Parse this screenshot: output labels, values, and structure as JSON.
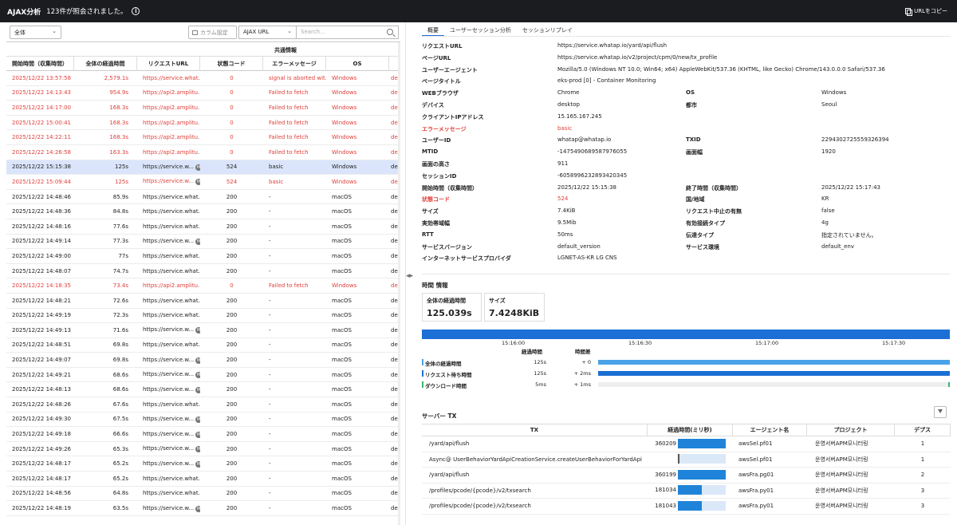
{
  "header": {
    "title": "AJAX分析",
    "count_text": "123件が照会されました。",
    "copy_url": "URLをコピー"
  },
  "filters": {
    "scope": "全体",
    "column_settings": "カラム設定",
    "field": "AJAX URL",
    "search_placeholder": "Search..."
  },
  "list": {
    "group_header": "共通情報",
    "columns": [
      "開始時間（収集時間）",
      "全体の経過時間",
      "リクエストURL",
      "状態コード",
      "エラーメッセージ",
      "OS"
    ],
    "rows": [
      {
        "time": "2025/12/22 13:57:58",
        "elapsed": "2,579.1s",
        "url": "https://service.what...",
        "status": "0",
        "error": "signal is aborted wit...",
        "os": "Windows",
        "extra": "de",
        "state": "error"
      },
      {
        "time": "2025/12/22 14:13:43",
        "elapsed": "954.9s",
        "url": "https://api2.amplitu...",
        "status": "0",
        "error": "Failed to fetch",
        "os": "Windows",
        "extra": "de",
        "state": "error"
      },
      {
        "time": "2025/12/22 14:17:00",
        "elapsed": "168.3s",
        "url": "https://api2.amplitu...",
        "status": "0",
        "error": "Failed to fetch",
        "os": "Windows",
        "extra": "de",
        "state": "error"
      },
      {
        "time": "2025/12/22 15:00:41",
        "elapsed": "168.3s",
        "url": "https://api2.amplitu...",
        "status": "0",
        "error": "Failed to fetch",
        "os": "Windows",
        "extra": "de",
        "state": "error"
      },
      {
        "time": "2025/12/22 14:22:11",
        "elapsed": "168.3s",
        "url": "https://api2.amplitu...",
        "status": "0",
        "error": "Failed to fetch",
        "os": "Windows",
        "extra": "de",
        "state": "error"
      },
      {
        "time": "2025/12/22 14:26:58",
        "elapsed": "163.3s",
        "url": "https://api2.amplitu...",
        "status": "0",
        "error": "Failed to fetch",
        "os": "Windows",
        "extra": "de",
        "state": "error"
      },
      {
        "time": "2025/12/22 15:15:38",
        "elapsed": "125s",
        "url": "https://service.w...",
        "badge": "M",
        "status": "524",
        "error": "basic",
        "os": "Windows",
        "extra": "de",
        "state": "selected"
      },
      {
        "time": "2025/12/22 15:09:44",
        "elapsed": "125s",
        "url": "https://service.w...",
        "badge": "M",
        "status": "524",
        "error": "basic",
        "os": "Windows",
        "extra": "de",
        "state": "error"
      },
      {
        "time": "2025/12/22 14:48:46",
        "elapsed": "85.9s",
        "url": "https://service.what...",
        "status": "200",
        "error": "-",
        "os": "macOS",
        "extra": "de",
        "state": "normal"
      },
      {
        "time": "2025/12/22 14:48:36",
        "elapsed": "84.8s",
        "url": "https://service.what...",
        "status": "200",
        "error": "-",
        "os": "macOS",
        "extra": "de",
        "state": "normal"
      },
      {
        "time": "2025/12/22 14:48:16",
        "elapsed": "77.6s",
        "url": "https://service.what...",
        "status": "200",
        "error": "-",
        "os": "macOS",
        "extra": "de",
        "state": "normal"
      },
      {
        "time": "2025/12/22 14:49:14",
        "elapsed": "77.3s",
        "url": "https://service.w...",
        "badge": "M",
        "status": "200",
        "error": "-",
        "os": "macOS",
        "extra": "de",
        "state": "normal"
      },
      {
        "time": "2025/12/22 14:49:00",
        "elapsed": "77s",
        "url": "https://service.what...",
        "status": "200",
        "error": "-",
        "os": "macOS",
        "extra": "de",
        "state": "normal"
      },
      {
        "time": "2025/12/22 14:48:07",
        "elapsed": "74.7s",
        "url": "https://service.what...",
        "status": "200",
        "error": "-",
        "os": "macOS",
        "extra": "de",
        "state": "normal"
      },
      {
        "time": "2025/12/22 14:18:35",
        "elapsed": "73.4s",
        "url": "https://api2.amplitu...",
        "status": "0",
        "error": "Failed to fetch",
        "os": "Windows",
        "extra": "de",
        "state": "error"
      },
      {
        "time": "2025/12/22 14:48:21",
        "elapsed": "72.6s",
        "url": "https://service.what...",
        "status": "200",
        "error": "-",
        "os": "macOS",
        "extra": "de",
        "state": "normal"
      },
      {
        "time": "2025/12/22 14:49:19",
        "elapsed": "72.3s",
        "url": "https://service.what...",
        "status": "200",
        "error": "-",
        "os": "macOS",
        "extra": "de",
        "state": "normal"
      },
      {
        "time": "2025/12/22 14:49:13",
        "elapsed": "71.6s",
        "url": "https://service.w...",
        "badge": "M",
        "status": "200",
        "error": "-",
        "os": "macOS",
        "extra": "de",
        "state": "normal"
      },
      {
        "time": "2025/12/22 14:48:51",
        "elapsed": "69.8s",
        "url": "https://service.what...",
        "status": "200",
        "error": "-",
        "os": "macOS",
        "extra": "de",
        "state": "normal"
      },
      {
        "time": "2025/12/22 14:49:07",
        "elapsed": "69.8s",
        "url": "https://service.w...",
        "badge": "M",
        "status": "200",
        "error": "-",
        "os": "macOS",
        "extra": "de",
        "state": "normal"
      },
      {
        "time": "2025/12/22 14:49:21",
        "elapsed": "68.6s",
        "url": "https://service.w...",
        "badge": "M",
        "status": "200",
        "error": "-",
        "os": "macOS",
        "extra": "de",
        "state": "normal"
      },
      {
        "time": "2025/12/22 14:48:13",
        "elapsed": "68.6s",
        "url": "https://service.w...",
        "badge": "M",
        "status": "200",
        "error": "-",
        "os": "macOS",
        "extra": "de",
        "state": "normal"
      },
      {
        "time": "2025/12/22 14:48:26",
        "elapsed": "67.6s",
        "url": "https://service.what...",
        "status": "200",
        "error": "-",
        "os": "macOS",
        "extra": "de",
        "state": "normal"
      },
      {
        "time": "2025/12/22 14:49:30",
        "elapsed": "67.5s",
        "url": "https://service.w...",
        "badge": "M",
        "status": "200",
        "error": "-",
        "os": "macOS",
        "extra": "de",
        "state": "normal"
      },
      {
        "time": "2025/12/22 14:49:18",
        "elapsed": "66.6s",
        "url": "https://service.w...",
        "badge": "M",
        "status": "200",
        "error": "-",
        "os": "macOS",
        "extra": "de",
        "state": "normal"
      },
      {
        "time": "2025/12/22 14:49:26",
        "elapsed": "65.3s",
        "url": "https://service.w...",
        "badge": "M",
        "status": "200",
        "error": "-",
        "os": "macOS",
        "extra": "de",
        "state": "normal"
      },
      {
        "time": "2025/12/22 14:48:17",
        "elapsed": "65.2s",
        "url": "https://service.w...",
        "badge": "M",
        "status": "200",
        "error": "-",
        "os": "macOS",
        "extra": "de",
        "state": "normal"
      },
      {
        "time": "2025/12/22 14:48:17",
        "elapsed": "65.2s",
        "url": "https://service.what...",
        "status": "200",
        "error": "-",
        "os": "macOS",
        "extra": "de",
        "state": "normal"
      },
      {
        "time": "2025/12/22 14:48:56",
        "elapsed": "64.8s",
        "url": "https://service.what...",
        "status": "200",
        "error": "-",
        "os": "macOS",
        "extra": "de",
        "state": "normal"
      },
      {
        "time": "2025/12/22 14:48:19",
        "elapsed": "63.5s",
        "url": "https://service.w...",
        "badge": "M",
        "status": "200",
        "error": "-",
        "os": "macOS",
        "extra": "de",
        "state": "normal"
      }
    ]
  },
  "tabs": [
    "概要",
    "ユーザーセッション分析",
    "セッションリプレイ"
  ],
  "details": [
    {
      "label": "リクエストURL",
      "value": "https://service.whatap.io/yard/api/flush"
    },
    {
      "label": "ページURL",
      "value": "https://service.whatap.io/v2/project/cpm/0/new/tx_profile"
    },
    {
      "label": "ユーザーエージェント",
      "value": "Mozilla/5.0 (Windows NT 10.0; Win64; x64) AppleWebKit/537.36 (KHTML, like Gecko) Chrome/143.0.0.0 Safari/537.36"
    },
    {
      "label": "ページタイトル",
      "value": "eks-prod [0] - Container Monitoring"
    },
    {
      "label": "WEBブラウザ",
      "value": "Chrome",
      "label2": "OS",
      "value2": "Windows"
    },
    {
      "label": "デバイス",
      "value": "desktop",
      "label2": "都市",
      "value2": "Seoul"
    },
    {
      "label": "クライアントIPアドレス",
      "value": "15.165.167.245"
    },
    {
      "label": "エラーメッセージ",
      "value": "basic",
      "red": true
    },
    {
      "label": "ユーザーID",
      "value": "whatap@whatap.io",
      "label2": "TXID",
      "value2": "2294302725559326394"
    },
    {
      "label": "MTID",
      "value": "-1475490689587976055",
      "label2": "画面幅",
      "value2": "1920"
    },
    {
      "label": "画面の高さ",
      "value": "911"
    },
    {
      "label": "セッションID",
      "value": "-6058996232893420345"
    },
    {
      "label": "開始時間（収集時間）",
      "value": "2025/12/22 15:15:38",
      "label2": "終了時間（収集時間）",
      "value2": "2025/12/22 15:17:43"
    },
    {
      "label": "状態コード",
      "value": "524",
      "red": true,
      "label2": "国/地域",
      "value2": "KR"
    },
    {
      "label": "サイズ",
      "value": "7.4KiB",
      "label2": "リクエスト中止の有無",
      "value2": "false"
    },
    {
      "label": "実効帯域幅",
      "value": "9.5Mib",
      "label2": "有効接続タイプ",
      "value2": "4g"
    },
    {
      "label": "RTT",
      "value": "50ms",
      "label2": "伝達タイプ",
      "value2": "指定されていません。"
    },
    {
      "label": "サービスバージョン",
      "value": "default_version",
      "label2": "サービス環境",
      "value2": "default_env"
    },
    {
      "label": "インターネットサービスプロバイダ",
      "value": "LGNET-AS-KR LG CNS"
    }
  ],
  "time_info": {
    "title": "時間 情報",
    "elapsed_label": "全体の経過時間",
    "elapsed_value": "125.039s",
    "size_label": "サイズ",
    "size_value": "7.4248KiB",
    "ticks": [
      "15:16:00",
      "15:16:30",
      "15:17:00",
      "15:17:30"
    ],
    "head_elapsed": "経過時間",
    "head_diff": "時間差",
    "rows": [
      {
        "label": "全体の経過時間",
        "elapsed": "125s",
        "diff": "+ 0",
        "color": "#4aa3e8",
        "start": 0,
        "fill": 1.0
      },
      {
        "label": "リクエスト待ち時間",
        "elapsed": "125s",
        "diff": "+ 2ms",
        "color": "#1c6fd4",
        "start": 0,
        "fill": 1.0
      },
      {
        "label": "ダウンロード時間",
        "elapsed": "5ms",
        "diff": "+ 1ms",
        "color": "#3cb371",
        "start": 0.996,
        "fill": 0.004
      }
    ]
  },
  "server_tx": {
    "title": "サーバー TX",
    "columns": [
      "TX",
      "経過時間(ミリ秒)",
      "エージェント名",
      "プロジェクト",
      "デプス"
    ],
    "max_duration": 360209,
    "rows": [
      {
        "tx": "/yard/api/flush",
        "duration": 360209,
        "duration_label": "360209",
        "agent": "awsSel.pf01",
        "project": "운영서버APM모니터링",
        "depth": "1"
      },
      {
        "tx": "Async@ UserBehaviorYardApiCreationService.createUserBehaviorForYardApi",
        "duration": 0,
        "duration_label": "",
        "agent": "awsSel.pf01",
        "project": "운영서버APM모니터링",
        "depth": "1"
      },
      {
        "tx": "/yard/api/flush",
        "duration": 360199,
        "duration_label": "360199",
        "agent": "awsFra.pg01",
        "project": "운영서버APM모니터링",
        "depth": "2"
      },
      {
        "tx": "/profiles/pcode/{pcode}/v2/txsearch",
        "duration": 181034,
        "duration_label": "181034",
        "agent": "awsFra.py01",
        "project": "운영서버APM모니터링",
        "depth": "3"
      },
      {
        "tx": "/profiles/pcode/{pcode}/v2/txsearch",
        "duration": 181043,
        "duration_label": "181043",
        "agent": "awsFra.py01",
        "project": "운영서버APM모니터링",
        "depth": "3"
      }
    ]
  }
}
